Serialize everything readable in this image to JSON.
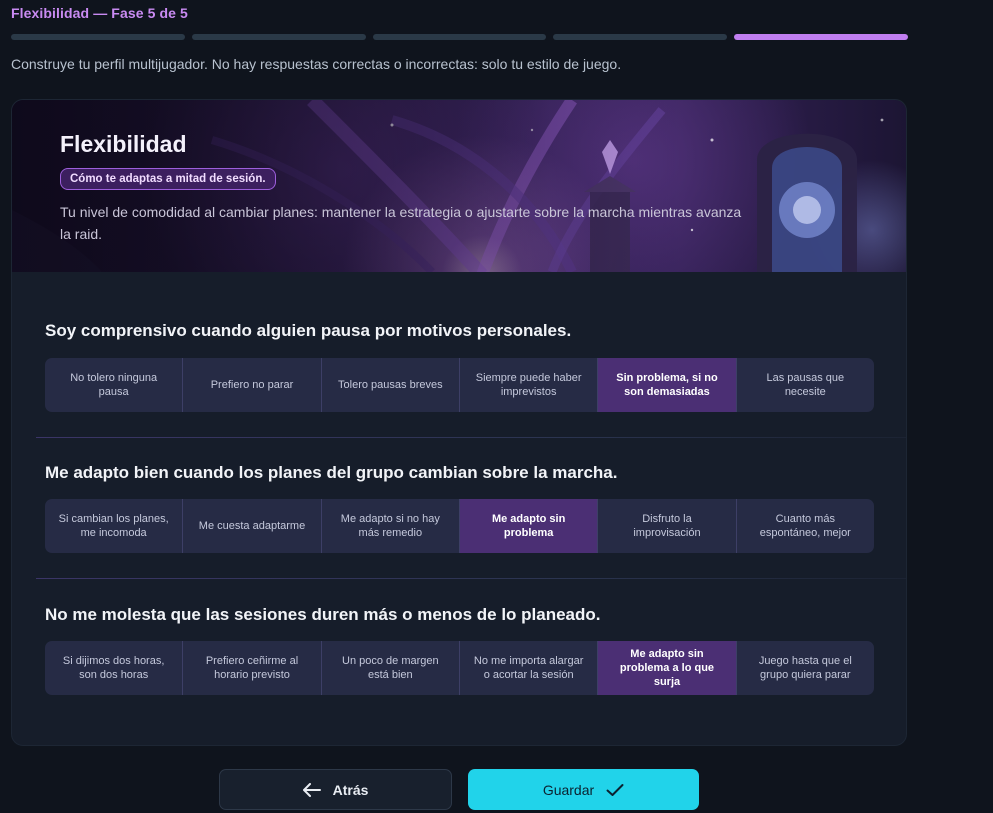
{
  "header": {
    "phase_title": "Flexibilidad — Fase 5 de 5",
    "progress": {
      "total_steps": 5,
      "current_step": 5
    },
    "subtitle": "Construye tu perfil multijugador. No hay respuestas correctas o incorrectas: solo tu estilo de juego."
  },
  "colors": {
    "accent_purple": "#c07ef0",
    "selected_option": "#4b2f74",
    "primary_button": "#21d3ea"
  },
  "section": {
    "title": "Flexibilidad",
    "badge": "Cómo te adaptas a mitad de sesión.",
    "description": "Tu nivel de comodidad al cambiar planes: mantener la estrategia o ajustarte sobre la marcha mientras avanza la raid."
  },
  "questions": [
    {
      "text": "Soy comprensivo cuando alguien pausa por motivos personales.",
      "options": [
        "No tolero ninguna pausa",
        "Prefiero no parar",
        "Tolero pausas breves",
        "Siempre puede haber imprevistos",
        "Sin problema, si no son demasiadas",
        "Las pausas que necesite"
      ],
      "selected_index": 4
    },
    {
      "text": "Me adapto bien cuando los planes del grupo cambian sobre la marcha.",
      "options": [
        "Si cambian los planes, me incomoda",
        "Me cuesta adaptarme",
        "Me adapto si no hay más remedio",
        "Me adapto sin problema",
        "Disfruto la improvisación",
        "Cuanto más espontáneo, mejor"
      ],
      "selected_index": 3
    },
    {
      "text": "No me molesta que las sesiones duren más o menos de lo planeado.",
      "options": [
        "Si dijimos dos horas, son dos horas",
        "Prefiero ceñirme al horario previsto",
        "Un poco de margen está bien",
        "No me importa alargar o acortar la sesión",
        "Me adapto sin problema a lo que surja",
        "Juego hasta que el grupo quiera parar"
      ],
      "selected_index": 4
    }
  ],
  "footer": {
    "back_label": "Atrás",
    "back_icon": "arrow-left-icon",
    "save_label": "Guardar",
    "save_icon": "check-icon"
  }
}
